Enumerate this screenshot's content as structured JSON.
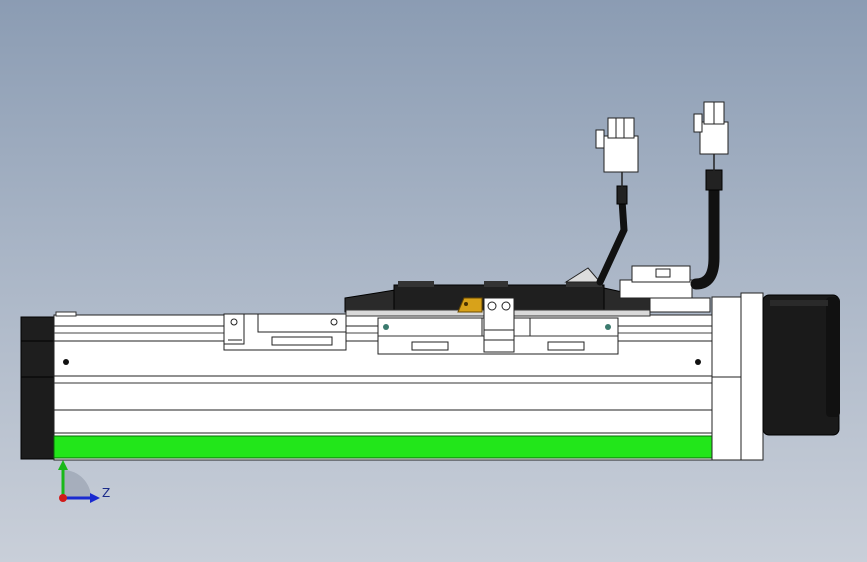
{
  "colors": {
    "background_top": "#8b9cb3",
    "background_bottom": "#c9cfd9",
    "rail_body": "#ffffff",
    "accent_strip": "#22e61a",
    "end_cap": "#1c1c1c",
    "motor": "#1a1a1a",
    "brass_nut": "#d8a21a",
    "triad_x": "#1a2ad0",
    "triad_y": "#19b819",
    "triad_origin": "#d01a1a"
  },
  "icons": {
    "triad": "coordinate-triad-icon",
    "connector": "cable-connector-icon"
  },
  "triad": {
    "axis_label": "Z"
  }
}
